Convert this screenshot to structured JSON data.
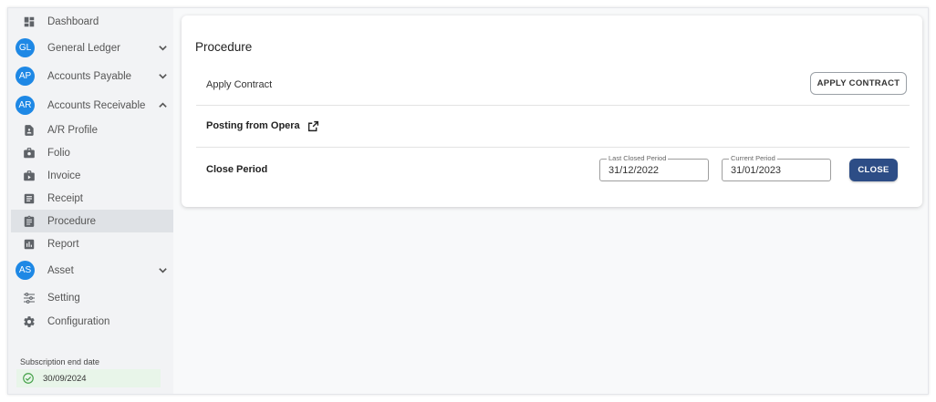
{
  "sidebar": {
    "items": [
      {
        "label": "Dashboard",
        "icon": "dashboard-icon"
      },
      {
        "label": "General Ledger",
        "avatar": "GL"
      },
      {
        "label": "Accounts Payable",
        "avatar": "AP"
      },
      {
        "label": "Accounts Receivable",
        "avatar": "AR"
      },
      {
        "label": "A/R Profile",
        "icon": "profile-icon"
      },
      {
        "label": "Folio",
        "icon": "folio-icon"
      },
      {
        "label": "Invoice",
        "icon": "invoice-icon"
      },
      {
        "label": "Receipt",
        "icon": "receipt-icon"
      },
      {
        "label": "Procedure",
        "icon": "procedure-icon",
        "active": true
      },
      {
        "label": "Report",
        "icon": "report-icon"
      },
      {
        "label": "Asset",
        "avatar": "AS"
      },
      {
        "label": "Setting",
        "icon": "sliders-icon"
      },
      {
        "label": "Configuration",
        "icon": "gear-icon"
      }
    ],
    "subscription_label": "Subscription end date",
    "subscription_date": "30/09/2024"
  },
  "main": {
    "title": "Procedure",
    "rows": {
      "apply_contract": {
        "label": "Apply Contract",
        "button": "APPLY CONTRACT"
      },
      "posting": {
        "label": "Posting from Opera"
      },
      "close_period": {
        "label": "Close Period",
        "last_closed_label": "Last Closed Period",
        "last_closed_value": "31/12/2022",
        "current_label": "Current Period",
        "current_value": "31/01/2023",
        "button": "CLOSE"
      }
    }
  },
  "colors": {
    "avatar": "#1e88e5",
    "primary_button": "#2d4d86",
    "subscription_bg": "#e8f5e9",
    "active_item": "#dfe2e6"
  }
}
